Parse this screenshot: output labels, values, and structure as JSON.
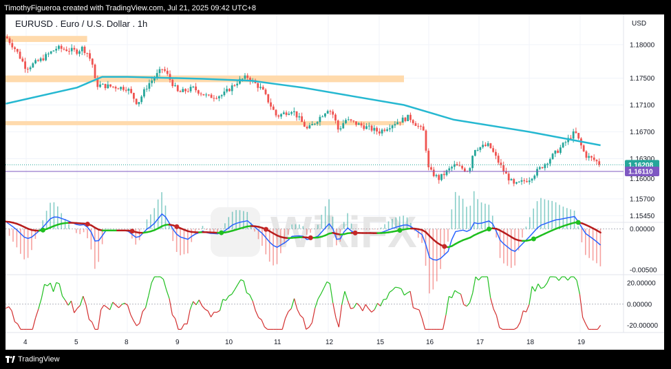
{
  "header": {
    "attribution": "TimothyFigueroa created with TradingView.com, Jul 21, 2025 09:42 UTC+8"
  },
  "symbol": {
    "title": "EURUSD . Euro / U.S. Dollar . 1h",
    "currency": "USD"
  },
  "footer": {
    "brand": "TradingView"
  },
  "colors": {
    "up": "#26a69a",
    "down": "#ef5350",
    "ma": "#26b8d1",
    "zone": "#ffd8a8",
    "current_price_bg": "#26a69a",
    "ref_price_bg": "#7e57c2",
    "macd_fast": "#2962ff",
    "osc_up": "#1fbf1f",
    "osc_down": "#d32f2f"
  },
  "chart_data": [
    {
      "type": "candlestick",
      "title": "EURUSD . Euro / U.S. Dollar . 1h",
      "ylabel": "USD",
      "x_ticks": [
        "4",
        "5",
        "8",
        "9",
        "10",
        "11",
        "12",
        "15",
        "16",
        "17",
        "18",
        "19"
      ],
      "y_ticks": [
        "1.18000",
        "1.17500",
        "1.17100",
        "1.16700",
        "1.16300",
        "1.16000",
        "1.15700",
        "1.15450"
      ],
      "ylim": [
        1.1535,
        1.1845
      ],
      "current_price": "1.16208",
      "reference_price": "1.16110",
      "zones": [
        {
          "from": 1.1804,
          "to": 1.1813,
          "end_day": 5.6
        },
        {
          "from": 1.1744,
          "to": 1.1754,
          "end_day": 15.5
        },
        {
          "from": 1.168,
          "to": 1.1686,
          "end_day": 15.5
        }
      ],
      "path_day": [
        3.6,
        3.8,
        4.0,
        4.3,
        4.6,
        5.0,
        5.3,
        5.6,
        5.9,
        6.0,
        6.1,
        8.0,
        8.2,
        8.4,
        8.7,
        9.0,
        9.3,
        9.6,
        9.9,
        10.2,
        10.4,
        10.7,
        11.0,
        11.3,
        11.6,
        12.0,
        12.3,
        12.6,
        13.0,
        15.0,
        15.3,
        15.6,
        15.9,
        16.0,
        16.2,
        16.5,
        16.8,
        16.9,
        17.2,
        17.5,
        17.7,
        18.0,
        18.3,
        18.6,
        18.9,
        19.1,
        19.3,
        19.4
      ],
      "path_price": [
        1.1812,
        1.1792,
        1.1765,
        1.1778,
        1.1795,
        1.179,
        1.1795,
        1.1788,
        1.1772,
        1.1762,
        1.174,
        1.1735,
        1.1712,
        1.174,
        1.1765,
        1.1728,
        1.1735,
        1.1722,
        1.1725,
        1.1745,
        1.1752,
        1.1733,
        1.1693,
        1.1703,
        1.1673,
        1.1705,
        1.1695,
        1.1672,
        1.1688,
        1.167,
        1.1683,
        1.1692,
        1.167,
        1.1613,
        1.16,
        1.162,
        1.1612,
        1.1645,
        1.165,
        1.161,
        1.159,
        1.16,
        1.1622,
        1.1645,
        1.167,
        1.1635,
        1.1627,
        1.1621
      ],
      "ma_day": [
        3.6,
        5.0,
        6.5,
        8.0,
        9.5,
        10.5,
        11.5,
        13.0,
        15.5,
        16.5,
        18.0,
        19.4
      ],
      "ma_price": [
        1.1712,
        1.1736,
        1.1752,
        1.1752,
        1.1749,
        1.1746,
        1.1736,
        1.1725,
        1.171,
        1.1688,
        1.167,
        1.165
      ]
    },
    {
      "type": "line",
      "y_ticks": [
        "0.00000",
        "-0.00500"
      ],
      "ylim": [
        -0.0056,
        0.0008
      ]
    },
    {
      "type": "line",
      "y_ticks": [
        "20.00000",
        "0.00000",
        "-20.00000"
      ],
      "ylim": [
        -27,
        28
      ]
    }
  ]
}
